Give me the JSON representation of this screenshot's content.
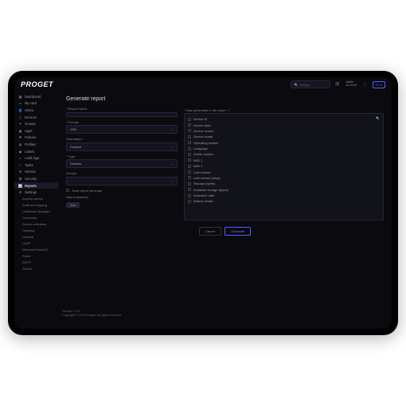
{
  "header": {
    "logo": "PROGET",
    "search_placeholder": "Szukaj",
    "user_name": "admin",
    "user_time": "do 24.09",
    "lang": "PL"
  },
  "sidebar": {
    "items": [
      {
        "icon": "▦",
        "label": "Dashboard"
      },
      {
        "icon": "▭",
        "label": "My card"
      },
      {
        "icon": "👤",
        "label": "Users"
      },
      {
        "icon": "▯",
        "label": "Devices"
      },
      {
        "icon": "⚘",
        "label": "Groups"
      },
      {
        "icon": "▦",
        "label": "Apps"
      },
      {
        "icon": "⚑",
        "label": "Policies"
      },
      {
        "icon": "▤",
        "label": "Profiles"
      },
      {
        "icon": "◉",
        "label": "Labels"
      },
      {
        "icon": "◐",
        "label": "Audit logs"
      },
      {
        "icon": "✓",
        "label": "Tasks"
      },
      {
        "icon": "⚙",
        "label": "Service"
      },
      {
        "icon": "🛡",
        "label": "Security"
      },
      {
        "icon": "📊",
        "label": "Reports"
      },
      {
        "icon": "⚙",
        "label": "Settings"
      }
    ],
    "subs": [
      "Access control",
      "Audit and logging",
      "Certificate Manager",
      "Connector",
      "Device activation",
      "Gateway",
      "General",
      "LDAP",
      "Microsoft Entra ID",
      "Roles",
      "SMTP",
      "Theme"
    ]
  },
  "page": {
    "title": "Generate report",
    "report_name_label": "* Report name:",
    "format_label": "* Format:",
    "format_value": "CSV",
    "orientation_label": "Orientation:",
    "orientation_value": "Content",
    "type_label": "* Type:",
    "type_value": "Devices",
    "groups_label": "Groups:",
    "send_email": "Send report via email",
    "add_recipients": "Add recipient(s)",
    "add_btn": "Add",
    "data_label": "* Data generated in the report:",
    "data_items": [
      "Device ID",
      "Device alias",
      "Device vendor",
      "Device model",
      "Operating system",
      "Language",
      "Serial number",
      "IMEI 1",
      "IMEI 2",
      "Last contact",
      "Last contact (days)",
      "Storage (bytes)",
      "Available storage (bytes)",
      "Activation date",
      "Battery health"
    ],
    "cancel": "Cancel",
    "generate": "Generate"
  },
  "footer": {
    "version": "Version: 2.76",
    "copyright": "Copyright © 2024 Proget. All rights reserved."
  }
}
